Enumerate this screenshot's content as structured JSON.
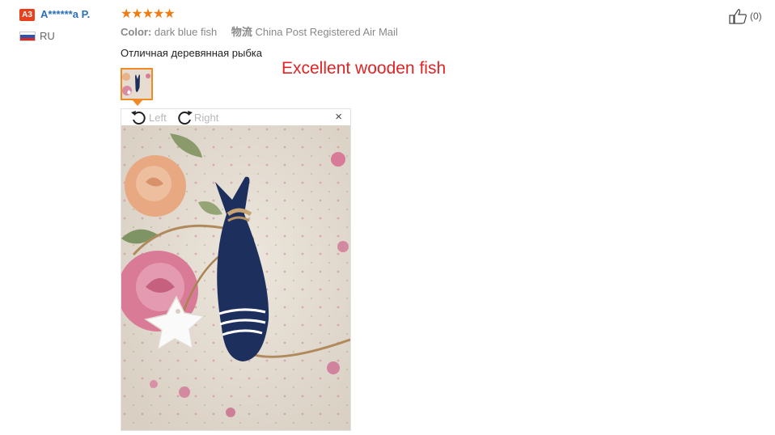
{
  "reviewer": {
    "badge": "A3",
    "name": "A******a P.",
    "country_code": "RU"
  },
  "rating": {
    "stars": 5,
    "star_glyphs": "★★★★★"
  },
  "meta": {
    "color_label": "Color:",
    "color_value": "dark blue fish",
    "shipping_label": "物流",
    "shipping_value": "China Post Registered Air Mail"
  },
  "review": {
    "text": "Отличная деревянная рыбка",
    "annotation": "Excellent wooden fish"
  },
  "viewer": {
    "rotate_left_label": "Left",
    "rotate_right_label": "Right",
    "close_glyph": "×"
  },
  "helpful": {
    "count_text": "(0)"
  },
  "colors": {
    "accent_orange": "#f08a24",
    "star_orange": "#f27b0f",
    "link_blue": "#2a6fb5",
    "badge_red": "#e8401c",
    "annotation_red": "#e02424",
    "fish_navy": "#1d2f5c"
  }
}
